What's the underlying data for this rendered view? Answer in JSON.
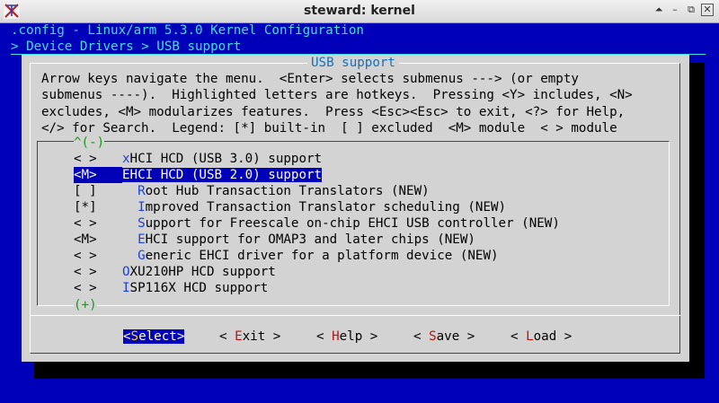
{
  "window": {
    "title": "steward: kernel"
  },
  "header": {
    "config_line": ".config - Linux/arm 5.3.0 Kernel Configuration",
    "breadcrumb": "> Device Drivers > USB support"
  },
  "dialog": {
    "title": "USB support",
    "help_lines": [
      "Arrow keys navigate the menu.  <Enter> selects submenus ---> (or empty",
      "submenus ----).  Highlighted letters are hotkeys.  Pressing <Y> includes, <N>",
      "excludes, <M> modularizes features.  Press <Esc><Esc> to exit, <?> for Help,",
      "</> for Search.  Legend: [*] built-in  [ ] excluded  <M> module  < > module"
    ],
    "scroll_up": "^(-)",
    "scroll_down": "(+)",
    "items": [
      {
        "mark": "< >",
        "indent": "",
        "hotkey": "x",
        "rest": "HCI HCD (USB 3.0) support"
      },
      {
        "mark": "<M>",
        "indent": "",
        "hotkey": "E",
        "rest": "HCI HCD (USB 2.0) support"
      },
      {
        "mark": "[ ]",
        "indent": "  ",
        "hotkey": "R",
        "rest": "oot Hub Transaction Translators (NEW)"
      },
      {
        "mark": "[*]",
        "indent": "  ",
        "hotkey": "I",
        "rest": "mproved Transaction Translator scheduling (NEW)"
      },
      {
        "mark": "< >",
        "indent": "  ",
        "hotkey": "S",
        "rest": "upport for Freescale on-chip EHCI USB controller (NEW)"
      },
      {
        "mark": "<M>",
        "indent": "  ",
        "hotkey": "E",
        "rest": "HCI support for OMAP3 and later chips (NEW)"
      },
      {
        "mark": "< >",
        "indent": "  ",
        "hotkey": "G",
        "rest": "eneric EHCI driver for a platform device (NEW)"
      },
      {
        "mark": "< >",
        "indent": "",
        "hotkey": "O",
        "rest": "XU210HP HCD support"
      },
      {
        "mark": "< >",
        "indent": "",
        "hotkey": "I",
        "rest": "SP116X HCD support"
      }
    ],
    "buttons": {
      "select": {
        "left": "<",
        "hotkey": "S",
        "rest": "elect",
        "right": ">"
      },
      "exit": {
        "left": "< ",
        "hotkey": "E",
        "rest": "xit",
        "right": " >"
      },
      "help": {
        "left": "< ",
        "hotkey": "H",
        "rest": "elp",
        "right": " >"
      },
      "save": {
        "left": "< ",
        "hotkey": "S",
        "rest": "ave",
        "right": " >"
      },
      "load": {
        "left": "< ",
        "hotkey": "L",
        "rest": "oad",
        "right": " >"
      }
    }
  },
  "colors": {
    "background": "#0000b8",
    "dialog": "#d3d3d3",
    "hotkey": "#1a3fe0",
    "button_hotkey": "#c01010",
    "scroll": "#1a9a1a",
    "header_text": "#40e0e0"
  }
}
